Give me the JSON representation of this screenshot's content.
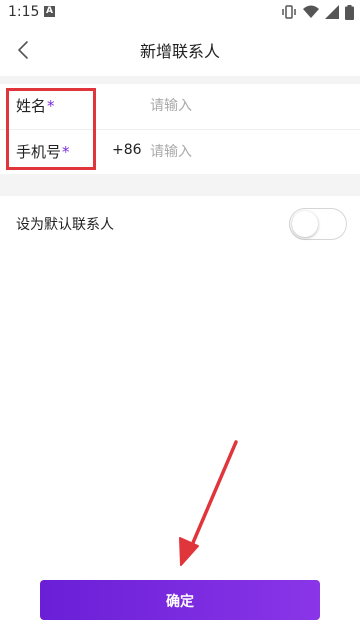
{
  "status_bar": {
    "time": "1:15",
    "notification_glyph": "A"
  },
  "header": {
    "title": "新增联系人"
  },
  "form": {
    "name": {
      "label": "姓名",
      "required_mark": "*",
      "placeholder": "请输入",
      "value": ""
    },
    "phone": {
      "label": "手机号",
      "required_mark": "*",
      "country_code": "+86",
      "placeholder": "请输入",
      "value": ""
    }
  },
  "default_contact": {
    "label": "设为默认联系人",
    "enabled": false
  },
  "confirm_button": {
    "label": "确定"
  },
  "colors": {
    "accent": "#7a2be0",
    "highlight_box": "#e0353b",
    "arrow": "#e0353b"
  }
}
